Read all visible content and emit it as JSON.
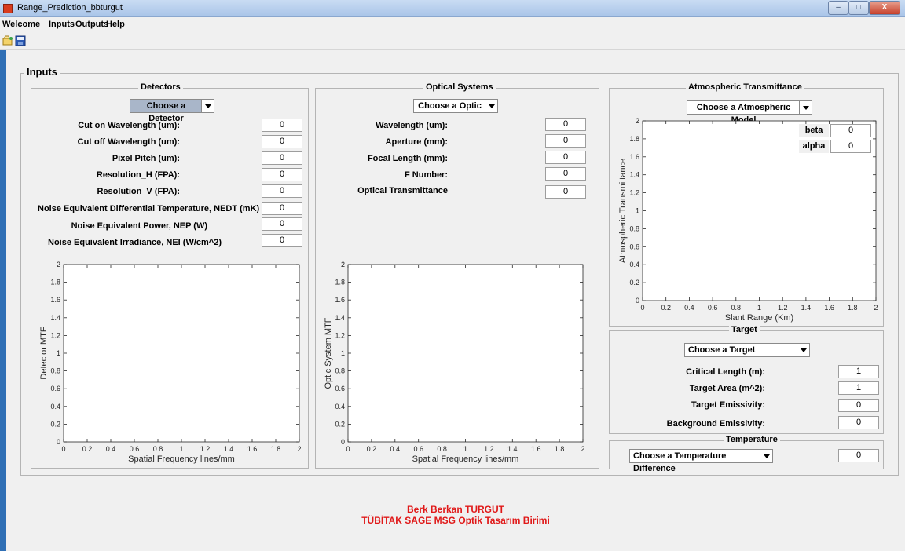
{
  "window": {
    "title": "Range_Prediction_bbturgut",
    "controls": {
      "minimize": "–",
      "maximize": "□",
      "close": "X"
    }
  },
  "menu": [
    "Welcome",
    "Inputs",
    "Outputs",
    "Help"
  ],
  "toolbar": {
    "icons": [
      "open-file-icon",
      "save-icon"
    ]
  },
  "inputs_panel": {
    "title": "Inputs"
  },
  "detectors": {
    "title": "Detectors",
    "dropdown": "Choose a Detector",
    "fields": [
      {
        "label": "Cut on Wavelength (um):",
        "value": "0"
      },
      {
        "label": "Cut off Wavelength (um):",
        "value": "0"
      },
      {
        "label": "Pixel Pitch (um):",
        "value": "0"
      },
      {
        "label": "Resolution_H (FPA):",
        "value": "0"
      },
      {
        "label": "Resolution_V (FPA):",
        "value": "0"
      },
      {
        "label": "Noise Equivalent Differential Temperature, NEDT (mK)",
        "value": "0"
      },
      {
        "label": "Noise Equivalent Power, NEP (W)",
        "value": "0"
      },
      {
        "label": "Noise Equivalent Irradiance, NEI (W/cm^2)",
        "value": "0"
      }
    ]
  },
  "optics": {
    "title": "Optical Systems",
    "dropdown": "Choose a Optic",
    "fields": [
      {
        "label": "Wavelength (um):",
        "value": "0"
      },
      {
        "label": "Aperture (mm):",
        "value": "0"
      },
      {
        "label": "Focal Length (mm):",
        "value": "0"
      },
      {
        "label": "F Number:",
        "value": "0"
      },
      {
        "label": "Optical Transmittance",
        "value": "0"
      }
    ]
  },
  "atmosphere": {
    "title": "Atmospheric Transmittance",
    "dropdown": "Choose a Atmospheric Model",
    "beta": {
      "label": "beta",
      "value": "0"
    },
    "alpha": {
      "label": "alpha",
      "value": "0"
    }
  },
  "target": {
    "title": "Target",
    "dropdown": "Choose a Target",
    "fields": [
      {
        "label": "Critical Length (m):",
        "value": "1"
      },
      {
        "label": "Target Area (m^2):",
        "value": "1"
      },
      {
        "label": "Target Emissivity:",
        "value": "0"
      },
      {
        "label": "Background Emissivity:",
        "value": "0"
      }
    ]
  },
  "temperature": {
    "title": "Temperature",
    "dropdown": "Choose a Temperature Difference",
    "value": "0"
  },
  "credits": {
    "line1": "Berk Berkan TURGUT",
    "line2": "TÜBİTAK SAGE MSG Optik Tasarım Birimi",
    "color": "#e01919"
  },
  "chart_data": [
    {
      "type": "line",
      "xlabel": "Spatial Frequency lines/mm",
      "ylabel": "Detector MTF",
      "xlim": [
        0,
        2
      ],
      "ylim": [
        0,
        2
      ],
      "xticks": [
        "0",
        "0.2",
        "0.4",
        "0.6",
        "0.8",
        "1",
        "1.2",
        "1.4",
        "1.6",
        "1.8",
        "2"
      ],
      "yticks": [
        "0",
        "0.2",
        "0.4",
        "0.6",
        "0.8",
        "1",
        "1.2",
        "1.4",
        "1.6",
        "1.8",
        "2"
      ],
      "series": []
    },
    {
      "type": "line",
      "xlabel": "Spatial Frequency lines/mm",
      "ylabel": "Optic System MTF",
      "xlim": [
        0,
        2
      ],
      "ylim": [
        0,
        2
      ],
      "xticks": [
        "0",
        "0.2",
        "0.4",
        "0.6",
        "0.8",
        "1",
        "1.2",
        "1.4",
        "1.6",
        "1.8",
        "2"
      ],
      "yticks": [
        "0",
        "0.2",
        "0.4",
        "0.6",
        "0.8",
        "1",
        "1.2",
        "1.4",
        "1.6",
        "1.8",
        "2"
      ],
      "series": []
    },
    {
      "type": "line",
      "xlabel": "Slant Range (Km)",
      "ylabel": "Atmospheric Transmittance",
      "xlim": [
        0,
        2
      ],
      "ylim": [
        0,
        2
      ],
      "xticks": [
        "0",
        "0.2",
        "0.4",
        "0.6",
        "0.8",
        "1",
        "1.2",
        "1.4",
        "1.6",
        "1.8",
        "2"
      ],
      "yticks": [
        "0",
        "0.2",
        "0.4",
        "0.6",
        "0.8",
        "1",
        "1.2",
        "1.4",
        "1.6",
        "1.8",
        "2"
      ],
      "series": []
    }
  ]
}
